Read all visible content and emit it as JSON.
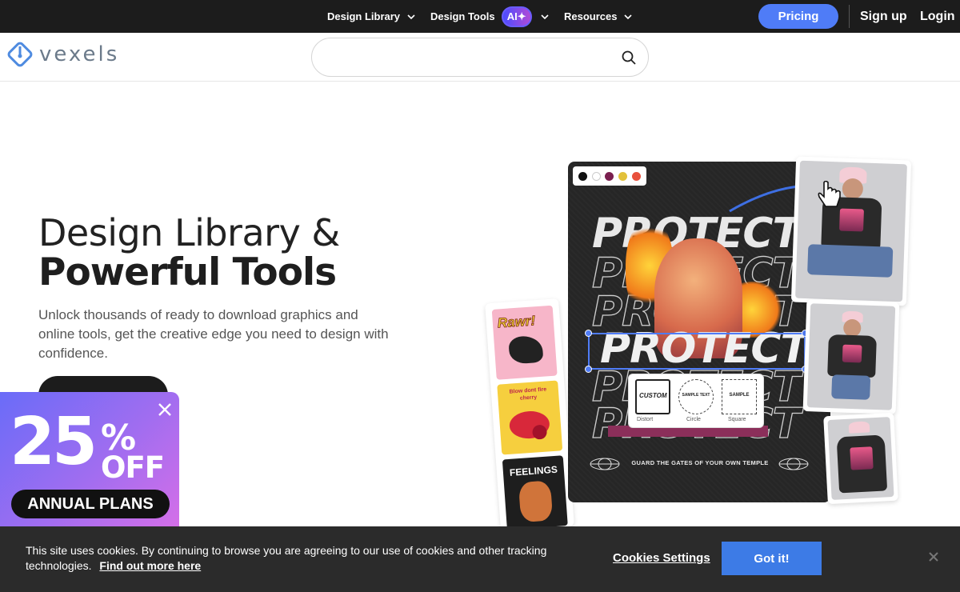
{
  "topnav": {
    "items": [
      {
        "label": "Design Library"
      },
      {
        "label": "Design Tools",
        "badge": "AI✦"
      },
      {
        "label": "Resources"
      }
    ],
    "pricing": "Pricing",
    "signup": "Sign up",
    "login": "Login"
  },
  "header": {
    "logo_text": "vexels",
    "search_placeholder": ""
  },
  "hero": {
    "title_line1": "Design Library &",
    "title_line2": "Powerful Tools",
    "description": "Unlock thousands of ready to download graphics and online tools, get the creative edge you need to design with confidence.",
    "illustration": {
      "word": "PROTECT",
      "tagline": "GUARD THE GATES OF YOUR OWN TEMPLE",
      "swatch_colors": [
        "#111111",
        "#ffffff",
        "#7a1f4f",
        "#e2c13a",
        "#e8503c"
      ],
      "shape_options": [
        {
          "label": "Distort",
          "sample": "CUSTOM"
        },
        {
          "label": "Circle",
          "sample": "SAMPLE TEXT"
        },
        {
          "label": "Square",
          "sample": "SAMPLE"
        }
      ],
      "stickers": [
        "Rawr!",
        "Blow dont fire cherry",
        "FEELINGS"
      ]
    }
  },
  "promo": {
    "number": "25",
    "percent": "%",
    "off": "OFF",
    "plan": "ANNUAL PLANS"
  },
  "cookie": {
    "text": "This site uses cookies. By continuing to browse you are agreeing to our use of cookies and other tracking technologies.",
    "link": "Find out more here",
    "settings": "Cookies Settings",
    "accept": "Got it!"
  },
  "colors": {
    "accent": "#4f7cf7",
    "topbar": "#1c1c1c",
    "cookie_bg": "#2b2b2b",
    "cookie_button": "#3d7be6"
  }
}
